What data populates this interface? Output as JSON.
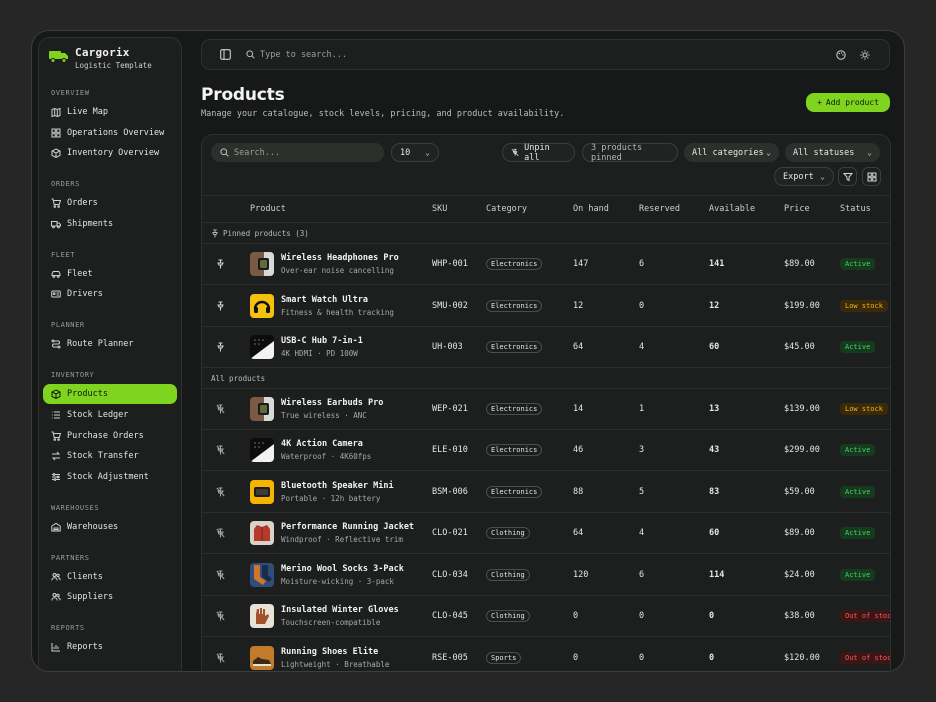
{
  "brand": {
    "name": "Cargorix",
    "subtitle": "Logistic Template",
    "accent": "#7fd41f"
  },
  "sidebar": {
    "sections": [
      {
        "label": "OVERVIEW",
        "items": [
          {
            "label": "Live Map",
            "icon": "map-icon"
          },
          {
            "label": "Operations Overview",
            "icon": "grid-icon"
          },
          {
            "label": "Inventory Overview",
            "icon": "box-icon"
          }
        ]
      },
      {
        "label": "ORDERS",
        "items": [
          {
            "label": "Orders",
            "icon": "cart-icon"
          },
          {
            "label": "Shipments",
            "icon": "truck-icon"
          }
        ]
      },
      {
        "label": "FLEET",
        "items": [
          {
            "label": "Fleet",
            "icon": "car-icon"
          },
          {
            "label": "Drivers",
            "icon": "id-card-icon"
          }
        ]
      },
      {
        "label": "PLANNER",
        "items": [
          {
            "label": "Route Planner",
            "icon": "route-icon"
          }
        ]
      },
      {
        "label": "INVENTORY",
        "items": [
          {
            "label": "Products",
            "icon": "cube-icon",
            "active": true
          },
          {
            "label": "Stock Ledger",
            "icon": "list-icon"
          },
          {
            "label": "Purchase Orders",
            "icon": "cart-icon"
          },
          {
            "label": "Stock Transfer",
            "icon": "transfer-icon"
          },
          {
            "label": "Stock Adjustment",
            "icon": "sliders-icon"
          }
        ]
      },
      {
        "label": "WAREHOUSES",
        "items": [
          {
            "label": "Warehouses",
            "icon": "warehouse-icon"
          }
        ]
      },
      {
        "label": "PARTNERS",
        "items": [
          {
            "label": "Clients",
            "icon": "users-icon"
          },
          {
            "label": "Suppliers",
            "icon": "user-group-icon"
          }
        ]
      },
      {
        "label": "REPORTS",
        "items": [
          {
            "label": "Reports",
            "icon": "chart-icon"
          }
        ]
      }
    ]
  },
  "topbar": {
    "search_placeholder": "Type to search..."
  },
  "page": {
    "title": "Products",
    "subtitle": "Manage your catalogue, stock levels, pricing, and product availability.",
    "add_button": "Add product"
  },
  "toolbar": {
    "search_placeholder": "Search...",
    "page_size": "10",
    "unpin_all": "Unpin all",
    "pinned_count": "3 products pinned",
    "category_filter": "All categories",
    "status_filter": "All statuses",
    "export": "Export"
  },
  "table": {
    "columns": [
      "Product",
      "SKU",
      "Category",
      "On hand",
      "Reserved",
      "Available",
      "Price",
      "Status"
    ],
    "pinned_label": "Pinned products (3)",
    "all_label": "All products",
    "pinned_rows": [
      {
        "name": "Wireless Headphones Pro",
        "desc": "Over-ear noise cancelling",
        "sku": "WHP-001",
        "category": "Electronics",
        "on_hand": "147",
        "reserved": "6",
        "available": "141",
        "price": "$89.00",
        "status": "Active",
        "status_kind": "active",
        "thumb": "watch-brown"
      },
      {
        "name": "Smart Watch Ultra",
        "desc": "Fitness & health tracking",
        "sku": "SMU-002",
        "category": "Electronics",
        "on_hand": "12",
        "reserved": "0",
        "available": "12",
        "price": "$199.00",
        "status": "Low stock",
        "status_kind": "low",
        "thumb": "headphones-yellow"
      },
      {
        "name": "USB-C Hub 7-in-1",
        "desc": "4K HDMI · PD 100W",
        "sku": "UH-003",
        "category": "Electronics",
        "on_hand": "64",
        "reserved": "4",
        "available": "60",
        "price": "$45.00",
        "status": "Active",
        "status_kind": "active",
        "thumb": "hub-white"
      }
    ],
    "rows": [
      {
        "name": "Wireless Earbuds Pro",
        "desc": "True wireless · ANC",
        "sku": "WEP-021",
        "category": "Electronics",
        "on_hand": "14",
        "reserved": "1",
        "available": "13",
        "price": "$139.00",
        "status": "Low stock",
        "status_kind": "low",
        "thumb": "watch-brown"
      },
      {
        "name": "4K Action Camera",
        "desc": "Waterproof · 4K60fps",
        "sku": "ELE-010",
        "category": "Electronics",
        "on_hand": "46",
        "reserved": "3",
        "available": "43",
        "price": "$299.00",
        "status": "Active",
        "status_kind": "active",
        "thumb": "hub-white"
      },
      {
        "name": "Bluetooth Speaker Mini",
        "desc": "Portable · 12h battery",
        "sku": "BSM-006",
        "category": "Electronics",
        "on_hand": "88",
        "reserved": "5",
        "available": "83",
        "price": "$59.00",
        "status": "Active",
        "status_kind": "active",
        "thumb": "speaker-yellow"
      },
      {
        "name": "Performance Running Jacket",
        "desc": "Windproof · Reflective trim",
        "sku": "CLO-021",
        "category": "Clothing",
        "on_hand": "64",
        "reserved": "4",
        "available": "60",
        "price": "$89.00",
        "status": "Active",
        "status_kind": "active",
        "thumb": "jacket-red"
      },
      {
        "name": "Merino Wool Socks 3-Pack",
        "desc": "Moisture-wicking · 3-pack",
        "sku": "CLO-034",
        "category": "Clothing",
        "on_hand": "120",
        "reserved": "6",
        "available": "114",
        "price": "$24.00",
        "status": "Active",
        "status_kind": "active",
        "thumb": "socks-blue"
      },
      {
        "name": "Insulated Winter Gloves",
        "desc": "Touchscreen-compatible",
        "sku": "CLO-045",
        "category": "Clothing",
        "on_hand": "0",
        "reserved": "0",
        "available": "0",
        "price": "$38.00",
        "status": "Out of stock",
        "status_kind": "out",
        "thumb": "gloves-tan"
      },
      {
        "name": "Running Shoes Elite",
        "desc": "Lightweight · Breathable",
        "sku": "RSE-005",
        "category": "Sports",
        "on_hand": "0",
        "reserved": "0",
        "available": "0",
        "price": "$120.00",
        "status": "Out of stock",
        "status_kind": "out",
        "thumb": "shoes-orange"
      }
    ]
  }
}
